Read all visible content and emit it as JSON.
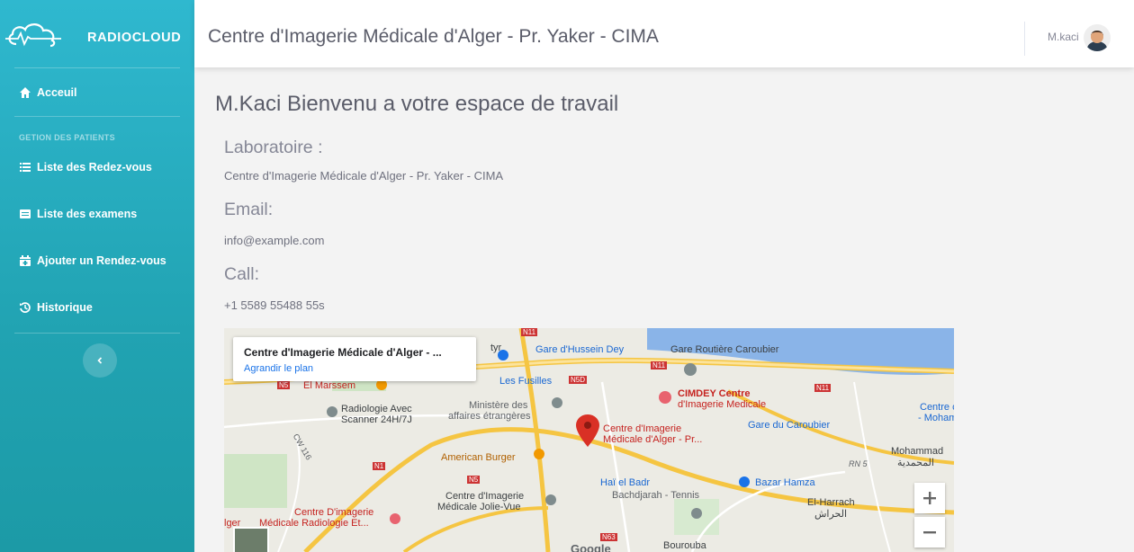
{
  "sidebar": {
    "brand": "RADIOCLOUD",
    "home_label": "Acceuil",
    "section_title": "GETION DES PATIENTS",
    "items": [
      {
        "label": "Liste des Redez-vous",
        "icon": "list-icon"
      },
      {
        "label": "Liste des examens",
        "icon": "table-icon"
      },
      {
        "label": "Ajouter un Rendez-vous",
        "icon": "calendar-plus-icon"
      },
      {
        "label": "Historique",
        "icon": "history-icon"
      }
    ]
  },
  "topbar": {
    "title": "Centre d'Imagerie Médicale d'Alger - Pr. Yaker - CIMA",
    "username": "M.kaci"
  },
  "main": {
    "welcome": "M.Kaci Bienvenu a votre espace de travail",
    "lab_label": "Laboratoire :",
    "lab_value": "Centre d'Imagerie Médicale d'Alger - Pr. Yaker - CIMA",
    "email_label": "Email:",
    "email_value": "info@example.com",
    "call_label": "Call:",
    "call_value": "+1 5589 55488 55s"
  },
  "map": {
    "card_title": "Centre d'Imagerie Médicale d'Alger - ...",
    "card_link": "Agrandir le plan",
    "labels": {
      "gare_hussein": "Gare d'Hussein Dey",
      "gare_routiere": "Gare Routière Caroubier",
      "el_marssem": "El Marssem",
      "les_fusilles": "Les Fusilles",
      "cimdey_1": "CIMDEY Centre",
      "cimdey_2": "d'Imagerie Medicale",
      "radiologie_1": "Radiologie Avec",
      "radiologie_2": "Scanner 24H/7J",
      "ministere_1": "Ministère des",
      "ministere_2": "affaires étrangères",
      "gare_caroubier": "Gare du Caroubier",
      "centre_co": "Centre co",
      "moham": "- Moham",
      "cima_1": "Centre d'Imagerie",
      "cima_2": "Médicale d'Alger - Pr...",
      "american_burger": "American Burger",
      "mohammadia": "Mohammad",
      "mohammadia_ar": "المحمدية",
      "hai_el_badr": "Haï el Badr",
      "bachdjarah": "Bachdjarah - Tennis",
      "bazar": "Bazar Hamza",
      "jolie_vue_1": "Centre d'Imagerie",
      "jolie_vue_2": "Médicale Jolie-Vue",
      "el_harrach": "El-Harrach",
      "el_harrach_ar": "الحراش",
      "radiologie_et_1": "Centre D'imagerie",
      "radiologie_et_2": "Médicale Radiologie Et...",
      "lger": "lger",
      "bourouba": "Bourouba",
      "google": "Google",
      "n11_a": "N11",
      "n11_b": "N11",
      "n11_c": "N11",
      "n5": "N5",
      "n5d": "N5D",
      "n1": "N1",
      "n5_b": "N5",
      "n63": "N63",
      "cw116": "CW 116",
      "rn5": "RN 5",
      "tyr": "tyr"
    }
  },
  "colors": {
    "sidebar_top": "#2fb8cf",
    "sidebar_bottom": "#1c9aa6",
    "marker": "#d93025"
  }
}
